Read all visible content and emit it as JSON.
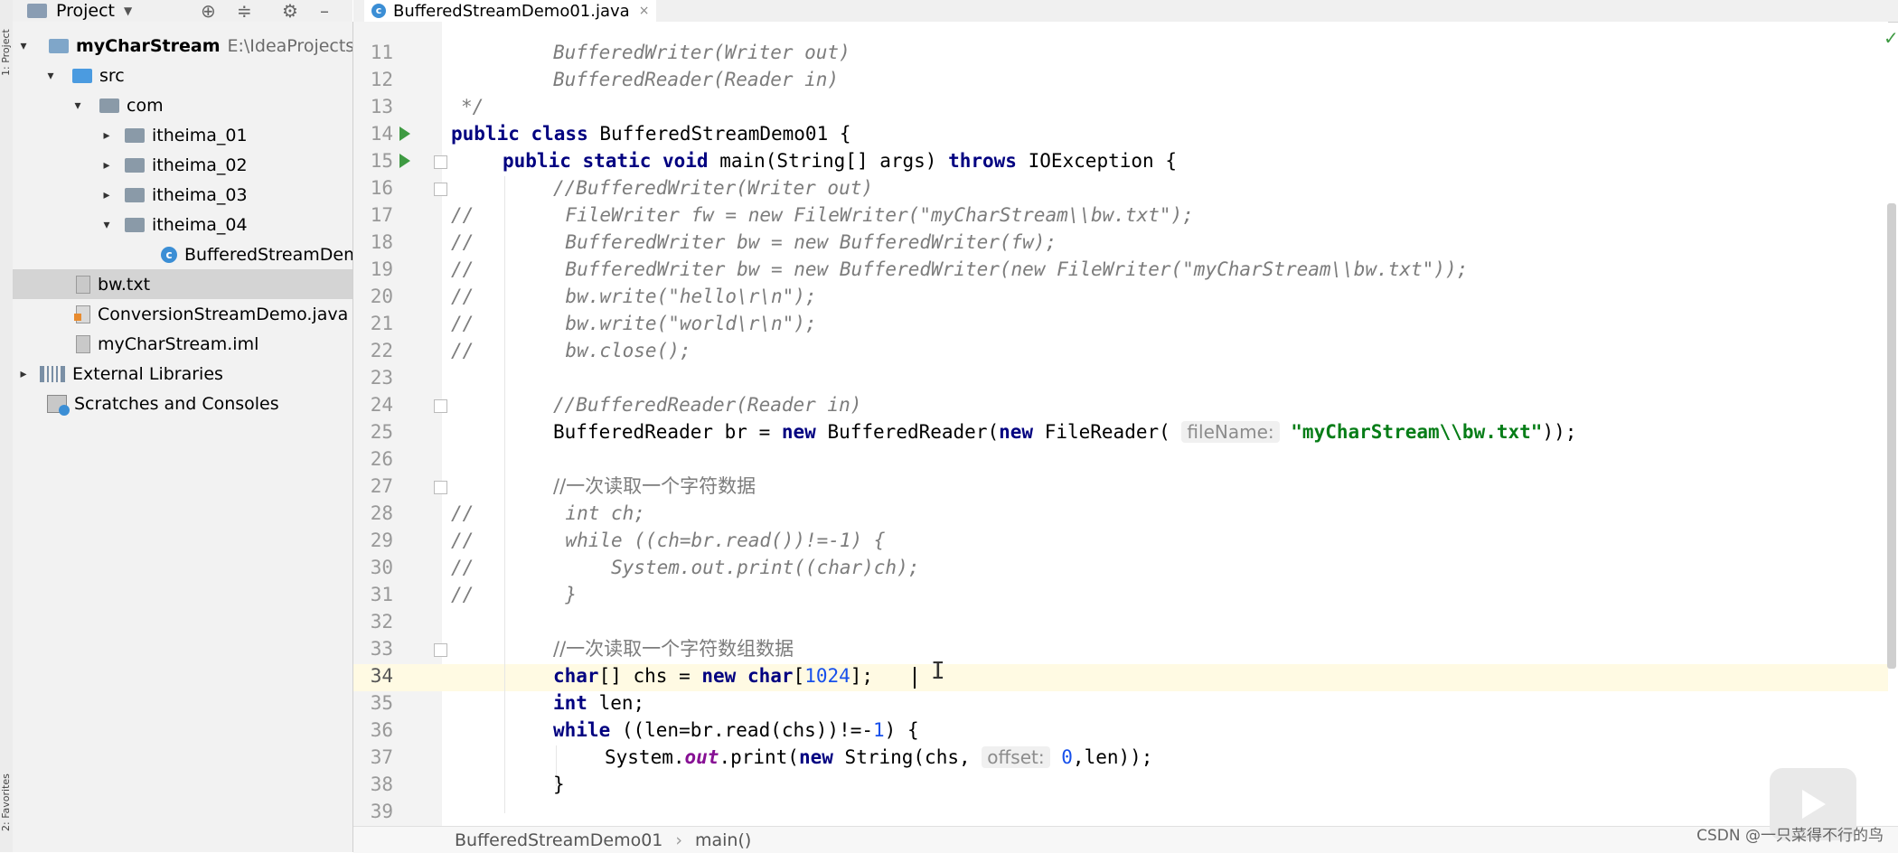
{
  "project_panel": {
    "title": "Project",
    "tree": [
      {
        "label": "myCharStream",
        "extra": "E:\\IdeaProjects\\Ja",
        "icon": "module-folder-icon",
        "arrow": "▾"
      },
      {
        "label": "src",
        "icon": "source-folder-icon",
        "arrow": "▾"
      },
      {
        "label": "com",
        "icon": "package-icon",
        "arrow": "▾"
      },
      {
        "label": "itheima_01",
        "icon": "package-icon",
        "arrow": "▸"
      },
      {
        "label": "itheima_02",
        "icon": "package-icon",
        "arrow": "▸"
      },
      {
        "label": "itheima_03",
        "icon": "package-icon",
        "arrow": "▸"
      },
      {
        "label": "itheima_04",
        "icon": "package-icon",
        "arrow": "▾"
      },
      {
        "label": "BufferedStreamDem",
        "icon": "java-class-icon",
        "arrow": ""
      },
      {
        "label": "bw.txt",
        "icon": "text-file-icon",
        "arrow": ""
      },
      {
        "label": "ConversionStreamDemo.java",
        "icon": "java-file-icon",
        "arrow": ""
      },
      {
        "label": "myCharStream.iml",
        "icon": "iml-file-icon",
        "arrow": ""
      },
      {
        "label": "External Libraries",
        "icon": "library-icon",
        "arrow": "▸"
      },
      {
        "label": "Scratches and Consoles",
        "icon": "scratches-icon",
        "arrow": ""
      }
    ]
  },
  "sidebar_tabs": {
    "top": "1: Project",
    "bottom": "2: Favorites"
  },
  "editor_tab": {
    "label": "BufferedStreamDemo01.java",
    "close": "×"
  },
  "code_lines": [
    {
      "n": "11"
    },
    {
      "n": "12"
    },
    {
      "n": "13"
    },
    {
      "n": "14"
    },
    {
      "n": "15"
    },
    {
      "n": "16"
    },
    {
      "n": "17"
    },
    {
      "n": "18"
    },
    {
      "n": "19"
    },
    {
      "n": "20"
    },
    {
      "n": "21"
    },
    {
      "n": "22"
    },
    {
      "n": "23"
    },
    {
      "n": "24"
    },
    {
      "n": "25"
    },
    {
      "n": "26"
    },
    {
      "n": "27"
    },
    {
      "n": "28"
    },
    {
      "n": "29"
    },
    {
      "n": "30"
    },
    {
      "n": "31"
    },
    {
      "n": "32"
    },
    {
      "n": "33"
    },
    {
      "n": "34"
    },
    {
      "n": "35"
    },
    {
      "n": "36"
    },
    {
      "n": "37"
    },
    {
      "n": "38"
    },
    {
      "n": "39"
    }
  ],
  "code": {
    "l11": "BufferedWriter(Writer out)",
    "l12": "BufferedReader(Reader in)",
    "l13": "*/",
    "l14_kw": "public class",
    "l14_rest": " BufferedStreamDemo01 {",
    "l15_kw1": "public static void",
    "l15_mid": " main(String[] args) ",
    "l15_kw2": "throws",
    "l15_rest": " IOException {",
    "l16": "//BufferedWriter(Writer out)",
    "l17": "//        FileWriter fw = new FileWriter(\"myCharStream\\\\bw.txt\");",
    "l18": "//        BufferedWriter bw = new BufferedWriter(fw);",
    "l19": "//        BufferedWriter bw = new BufferedWriter(new FileWriter(\"myCharStream\\\\bw.txt\"));",
    "l20": "//        bw.write(\"hello\\r\\n\");",
    "l21": "//        bw.write(\"world\\r\\n\");",
    "l22": "//        bw.close();",
    "l24": "//BufferedReader(Reader in)",
    "l25_a": "BufferedReader br = ",
    "l25_new1": "new",
    "l25_b": " BufferedReader(",
    "l25_new2": "new",
    "l25_c": " FileReader( ",
    "l25_hint": "fileName:",
    "l25_str": "\"myCharStream\\\\bw.txt\"",
    "l25_d": "));",
    "l27": "//一次读取一个字符数据",
    "l28": "//        int ch;",
    "l29": "//        while ((ch=br.read())!=-1) {",
    "l30": "//            System.out.print((char)ch);",
    "l31": "//        }",
    "l33": "//一次读取一个字符数组数据",
    "l34_kw1": "char",
    "l34_a": "[] chs = ",
    "l34_kw2": "new char",
    "l34_b": "[",
    "l34_num": "1024",
    "l34_c": "];",
    "l35_kw": "int",
    "l35_rest": " len;",
    "l36_kw": "while",
    "l36_a": " ((len=br.read(chs))!=-",
    "l36_num": "1",
    "l36_b": ") {",
    "l37_a": "System.",
    "l37_out": "out",
    "l37_b": ".print(",
    "l37_new": "new",
    "l37_c": " String(chs, ",
    "l37_hint": "offset:",
    "l37_num": "0",
    "l37_d": ",len));",
    "l38": "}"
  },
  "breadcrumb": {
    "class": "BufferedStreamDemo01",
    "method": "main()",
    "sep": "›"
  },
  "watermark": "CSDN @一只菜得不行的鸟",
  "colors": {
    "keyword": "#000080",
    "string": "#067d17",
    "comment": "#7c7c7c",
    "number": "#1750eb",
    "current_line": "#fffae3"
  }
}
